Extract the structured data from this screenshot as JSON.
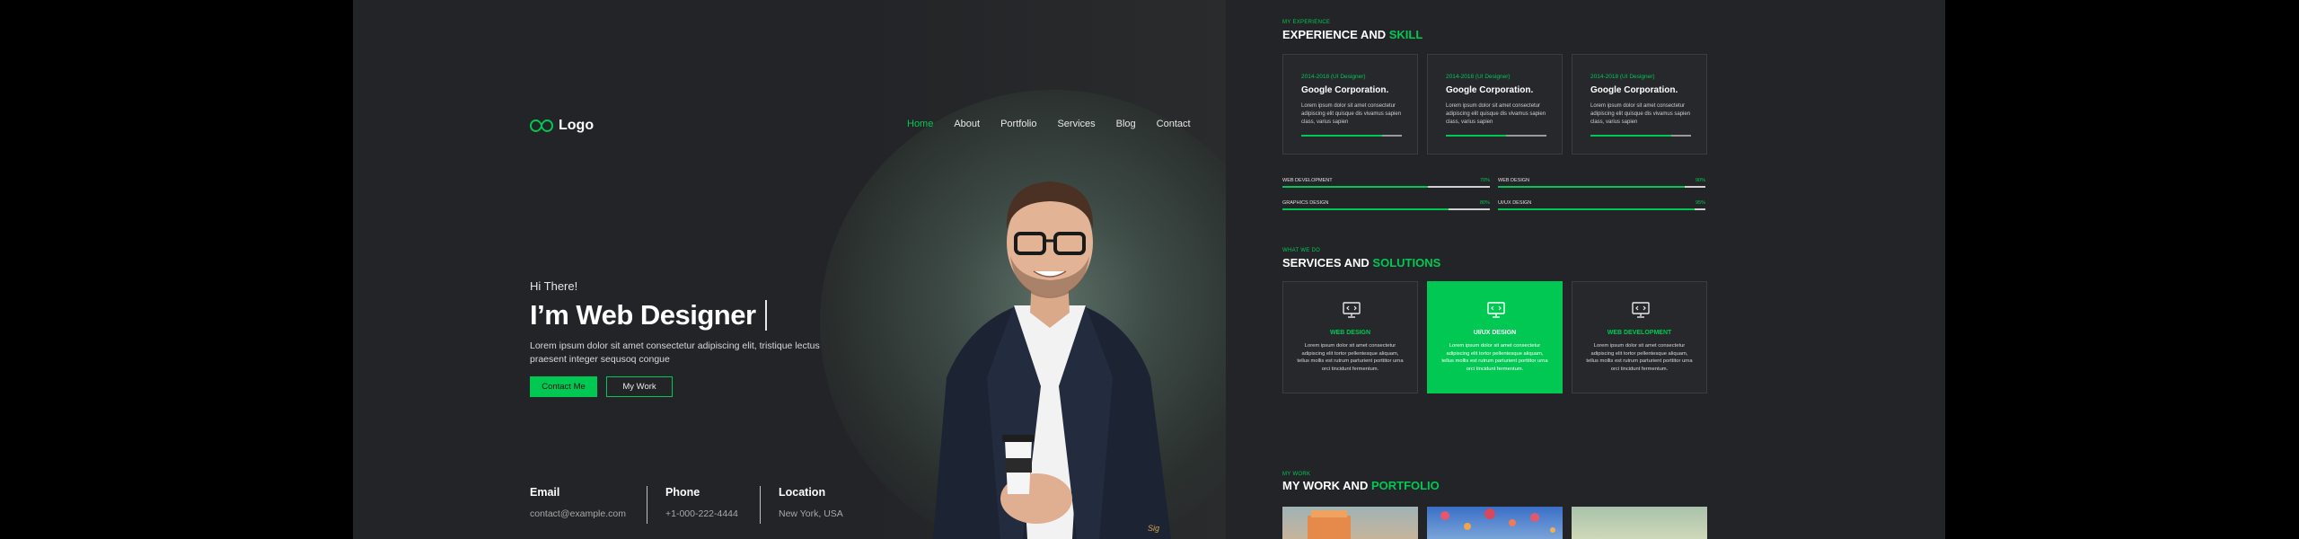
{
  "brand": {
    "logo_text": "Logo",
    "accent": "#00c853",
    "background": "#232427"
  },
  "nav": {
    "items": [
      {
        "label": "Home",
        "active": true
      },
      {
        "label": "About"
      },
      {
        "label": "Portfolio"
      },
      {
        "label": "Services"
      },
      {
        "label": "Blog"
      },
      {
        "label": "Contact"
      }
    ]
  },
  "hero": {
    "greeting": "Hi There!",
    "headline": "I’m Web Designer",
    "intro": "Lorem ipsum dolor sit amet consectetur adipiscing elit, tristique lectus praesent integer sequsoq congue",
    "primary_button": "Contact Me",
    "secondary_button": "My Work",
    "signature": "Sig"
  },
  "contact": [
    {
      "label": "Email",
      "value": "contact@example.com"
    },
    {
      "label": "Phone",
      "value": "+1-000-222-4444"
    },
    {
      "label": "Location",
      "value": "New York, USA"
    }
  ],
  "experience": {
    "kicker": "MY EXPERIENCE",
    "title_plain": "EXPERIENCE AND ",
    "title_highlight": "SKILL",
    "cards": [
      {
        "date": "2014-2018 (UI Designer)",
        "company": "Google Corporation.",
        "desc": "Lorem ipsum dolor sit amet consectetur adipiscing elit quisque dis vivamus sapien class, varius sapien",
        "progress": 0.8
      },
      {
        "date": "2014-2018 (UI Designer)",
        "company": "Google Corporation.",
        "desc": "Lorem ipsum dolor sit amet consectetur adipiscing elit quisque dis vivamus sapien class, varius sapien",
        "progress": 0.6
      },
      {
        "date": "2014-2018 (UI Designer)",
        "company": "Google Corporation.",
        "desc": "Lorem ipsum dolor sit amet consectetur adipiscing elit quisque dis vivamus sapien class, varius sapien",
        "progress": 0.8
      }
    ],
    "skills": [
      {
        "name": "WEB DEVELOPMENT",
        "pct": "70%",
        "value": 0.7
      },
      {
        "name": "WEB DESIGN",
        "pct": "90%",
        "value": 0.9
      },
      {
        "name": "GRAPHICS DESIGN",
        "pct": "80%",
        "value": 0.8
      },
      {
        "name": "UI/UX DESIGN",
        "pct": "95%",
        "value": 0.95
      }
    ]
  },
  "services": {
    "kicker": "WHAT WE DO",
    "title_plain": "SERVICES AND ",
    "title_highlight": "SOLUTIONS",
    "cards": [
      {
        "name": "WEB DESIGN",
        "desc": "Lorem ipsum dolor sit amet consectetur adipiscing elit tortor pellentesque aliquam, tellus mollis est rutrum parturient porttitor urna orci tincidunt fermentum.",
        "icon": "monitor-icon",
        "active": false
      },
      {
        "name": "UI/UX DESIGN",
        "desc": "Lorem ipsum dolor sit amet consectetur adipiscing elit tortor pellentesque aliquam, tellus mollis est rutrum parturient porttitor urna orci tincidunt fermentum.",
        "icon": "monitor-icon",
        "active": true
      },
      {
        "name": "WEB DEVELOPMENT",
        "desc": "Lorem ipsum dolor sit amet consectetur adipiscing elit tortor pellentesque aliquam, tellus mollis est rutrum parturient porttitor urna orci tincidunt fermentum.",
        "icon": "monitor-icon",
        "active": false
      }
    ]
  },
  "work": {
    "kicker": "MY WORK",
    "title_plain": "MY WORK AND ",
    "title_highlight": "PORTFOLIO"
  }
}
